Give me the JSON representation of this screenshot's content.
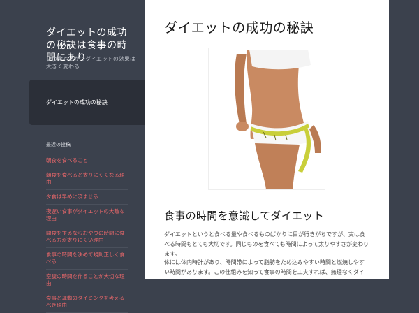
{
  "site": {
    "title": "ダイエットの成功の秘訣は食事の時間にあり",
    "description": "いつ食べるかでダイエットの効果は大きく変わる"
  },
  "sidebar": {
    "panel_label": "ダイエットの成功の秘訣",
    "widget_title": "最近の投稿",
    "items": [
      {
        "label": "朝食を食べること"
      },
      {
        "label": "朝食を食べると太りにくくなる理由"
      },
      {
        "label": "夕食は早めに済ませる"
      },
      {
        "label": "夜遅い食事がダイエットの大敵な理由"
      },
      {
        "label": "間食をするならおやつの時間に食べる方が太りにくい理由"
      },
      {
        "label": "食事の時間を決めて規則正しく食べる"
      },
      {
        "label": "空腹の時間を作ることが大切な理由"
      },
      {
        "label": "食事と運動のタイミングを考えるべき理由"
      }
    ]
  },
  "main": {
    "post_title": "ダイエットの成功の秘訣",
    "image_alt": "measuring-tape-waist-photo",
    "section_heading": "食事の時間を意識してダイエット",
    "paragraphs": [
      "ダイエットというと食べる量や食べるものばかりに目が行きがちですが、実は食べる時間もとても大切です。同じものを食べても時間によって太りやすさが変わります。",
      "体には体内時計があり、時間帯によって脂肪をため込みやすい時間と燃焼しやすい時間があります。この仕組みを知って食事の時間を工夫すれば、無理なくダイエットを成功させることができます。"
    ]
  },
  "colors": {
    "sidebar_bg": "#3b414d",
    "panel_bg": "#2b2f38",
    "link": "#e8676a",
    "main_bg": "#ffffff"
  }
}
